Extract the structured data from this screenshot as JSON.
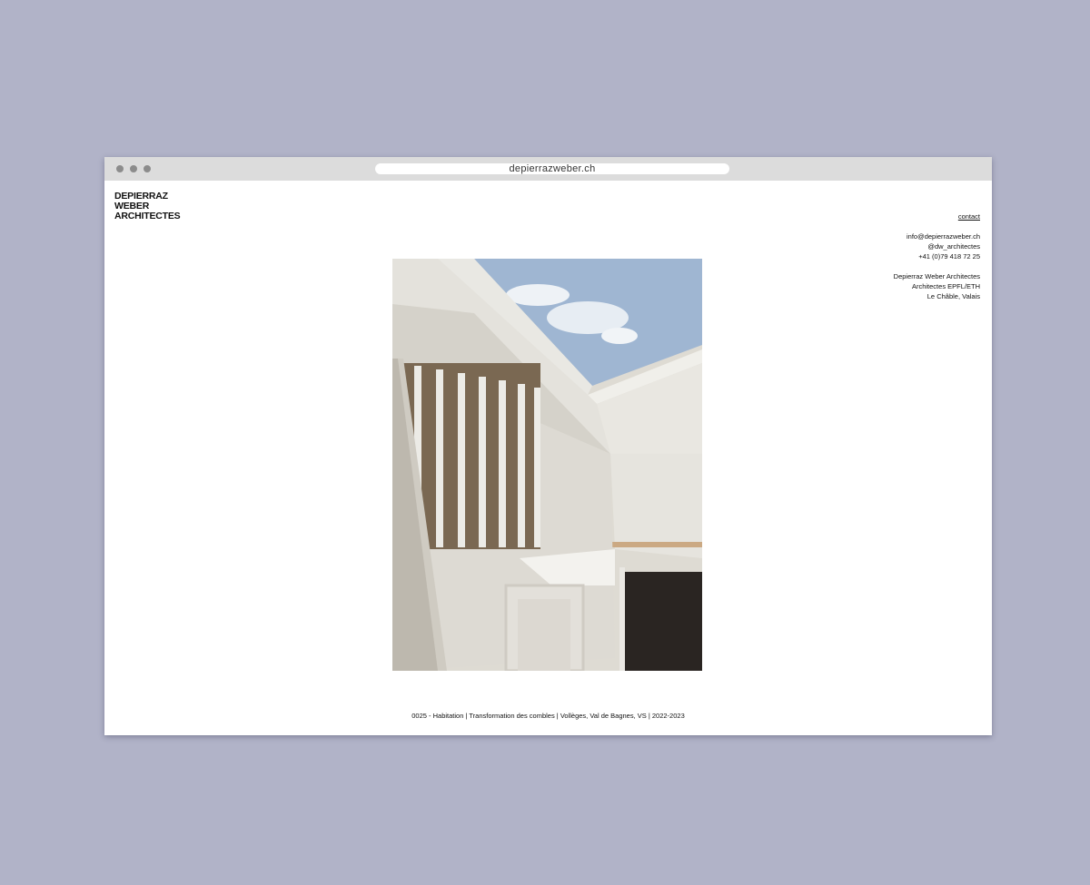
{
  "browser": {
    "url": "depierrazweber.ch"
  },
  "site": {
    "logo_lines": [
      "DEPIERRAZ",
      "WEBER",
      "ARCHITECTES"
    ],
    "nav": {
      "contact_label": "contact"
    },
    "contact_info": {
      "email": "info@depierrazweber.ch",
      "instagram": "@dw_architectes",
      "phone": "+41 (0)79 418 72 25",
      "company": "Depierraz Weber Architectes",
      "credentials": "Architectes EPFL/ETH",
      "location": "Le Châble, Valais"
    },
    "project_caption": "0025 - Habitation | Transformation des combles | Vollèges, Val de Bagnes, VS | 2022-2023"
  },
  "colors": {
    "background": "#b1b3c8",
    "window": "#ffffff",
    "titlebar": "#dcdcdc"
  }
}
